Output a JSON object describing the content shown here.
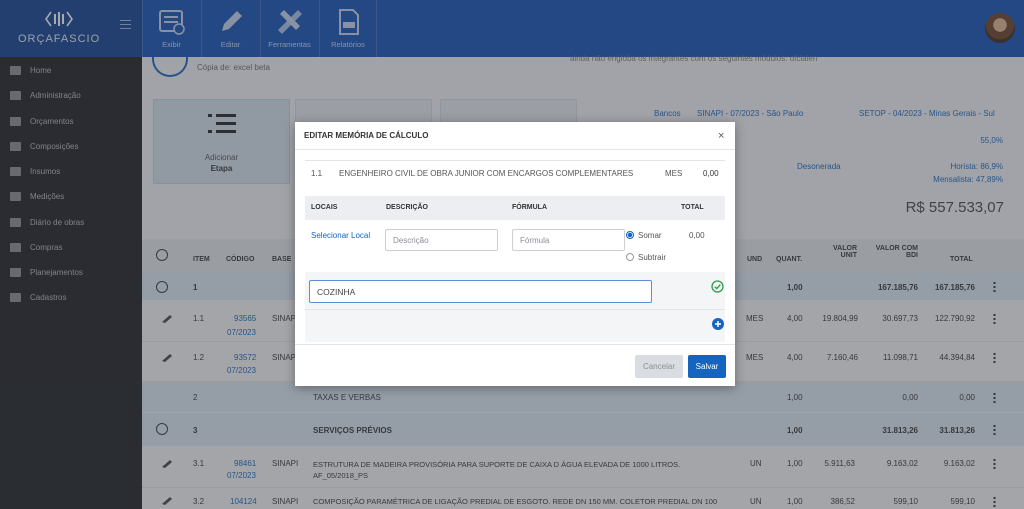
{
  "app": {
    "logo_text": "ORÇAFASCIO"
  },
  "toolbar": [
    {
      "label": "Exibir",
      "icon": "view-icon"
    },
    {
      "label": "Editar",
      "icon": "pencil-icon"
    },
    {
      "label": "Ferramentas",
      "icon": "tools-icon"
    },
    {
      "label": "Relatórios",
      "icon": "report-icon"
    }
  ],
  "sidebar": {
    "items": [
      {
        "label": "Home",
        "icon": "home-icon"
      },
      {
        "label": "Administração",
        "icon": "admin-icon"
      },
      {
        "label": "Orçamentos",
        "icon": "list-icon"
      },
      {
        "label": "Composições",
        "icon": "composition-icon"
      },
      {
        "label": "Insumos",
        "icon": "supplies-icon"
      },
      {
        "label": "Medições",
        "icon": "measure-icon"
      },
      {
        "label": "Diário de obras",
        "icon": "diary-icon"
      },
      {
        "label": "Compras",
        "icon": "cart-icon"
      },
      {
        "label": "Planejamentos",
        "icon": "calendar-icon"
      },
      {
        "label": "Cadastros",
        "icon": "register-icon"
      }
    ]
  },
  "header": {
    "subtitle": "Cópia de: excel beta",
    "warning": "ainda não engloba os integrantes com os seguintes módulos: ofcialen",
    "add_label": "Adicionar",
    "add_sub": "Etapa"
  },
  "info": {
    "banks_label": "Bancos",
    "bank1": "SINAPI - 07/2023 - São Paulo",
    "bank2": "SETOP - 04/2023 - Minas Gerais - Sul",
    "bdi": "55,0%",
    "desonerada": "Desonerada",
    "horista": "Horista: 86,9%",
    "mensalista": "Mensalista: 47,89%",
    "total": "R$ 557.533,07"
  },
  "table": {
    "headers": {
      "item": "ITEM",
      "codigo": "CÓDIGO",
      "base": "BASE",
      "und": "UND",
      "quant": "QUANT.",
      "valor_unit": "VALOR UNIT",
      "valor_bdi": "VALOR COM BDI",
      "total": "TOTAL"
    },
    "rows": [
      {
        "item": "1",
        "code": "",
        "date": "",
        "base": "",
        "desc": "",
        "und": "",
        "quant": "1,00",
        "vu": "",
        "vb": "167.185,76",
        "total": "167.185,76",
        "stage": true
      },
      {
        "item": "1.1",
        "code": "93565",
        "date": "07/2023",
        "base": "SINAP",
        "desc": "",
        "und": "MES",
        "quant": "4,00",
        "vu": "19.804,99",
        "vb": "30.697,73",
        "total": "122.790,92",
        "stage": false
      },
      {
        "item": "1.2",
        "code": "93572",
        "date": "07/2023",
        "base": "SINAP",
        "desc": "",
        "und": "MES",
        "quant": "4,00",
        "vu": "7.160,46",
        "vb": "11.098,71",
        "total": "44.394,84",
        "stage": false
      },
      {
        "item": "2",
        "code": "",
        "date": "",
        "base": "",
        "desc": "TAXAS E VERBAS",
        "und": "",
        "quant": "1,00",
        "vu": "",
        "vb": "0,00",
        "total": "0,00",
        "stage": true
      },
      {
        "item": "3",
        "code": "",
        "date": "",
        "base": "",
        "desc": "SERVIÇOS PRÉVIOS",
        "und": "",
        "quant": "1,00",
        "vu": "",
        "vb": "31.813,26",
        "total": "31.813,26",
        "stage": true
      },
      {
        "item": "3.1",
        "code": "98461",
        "date": "07/2023",
        "base": "SINAPI",
        "desc": "ESTRUTURA DE MADEIRA PROVISÓRIA PARA SUPORTE DE CAIXA D ÁGUA ELEVADA DE 1000 LITROS. AF_05/2018_PS",
        "und": "UN",
        "quant": "1,00",
        "vu": "5.911,63",
        "vb": "9.163,02",
        "total": "9.163,02",
        "stage": false
      },
      {
        "item": "3.2",
        "code": "104124",
        "date": "",
        "base": "SINAPI",
        "desc": "COMPOSIÇÃO PARAMÉTRICA DE LIGAÇÃO PREDIAL DE ESGOTO. REDE DN 150 MM. COLETOR PREDIAL DN 100",
        "und": "UN",
        "quant": "1,00",
        "vu": "386,52",
        "vb": "599,10",
        "total": "599,10",
        "stage": false
      }
    ]
  },
  "modal": {
    "title": "EDITAR MEMÓRIA DE CÁLCULO",
    "close": "×",
    "item_num": "1.1",
    "item_desc": "ENGENHEIRO CIVIL DE OBRA JUNIOR COM ENCARGOS COMPLEMENTARES",
    "item_unit": "MES",
    "item_value": "0,00",
    "col_locais": "LOCAIS",
    "col_desc": "DESCRIÇÃO",
    "col_formula": "FÓRMULA",
    "col_total": "TOTAL",
    "select_local": "Selecionar Local",
    "desc_placeholder": "Descrição",
    "formula_placeholder": "Fórmula",
    "somar": "Somar",
    "subtrair": "Subtrair",
    "row_total": "0,00",
    "local_value": "COZINHA",
    "cancel": "Cancelar",
    "save": "Salvar"
  },
  "colors": {
    "primary": "#0f4fb5",
    "sidebar": "#1c1d21",
    "stage_row": "#dfe9f6",
    "accent_blue": "#1565c0",
    "confirm_green": "#2e9e44"
  }
}
